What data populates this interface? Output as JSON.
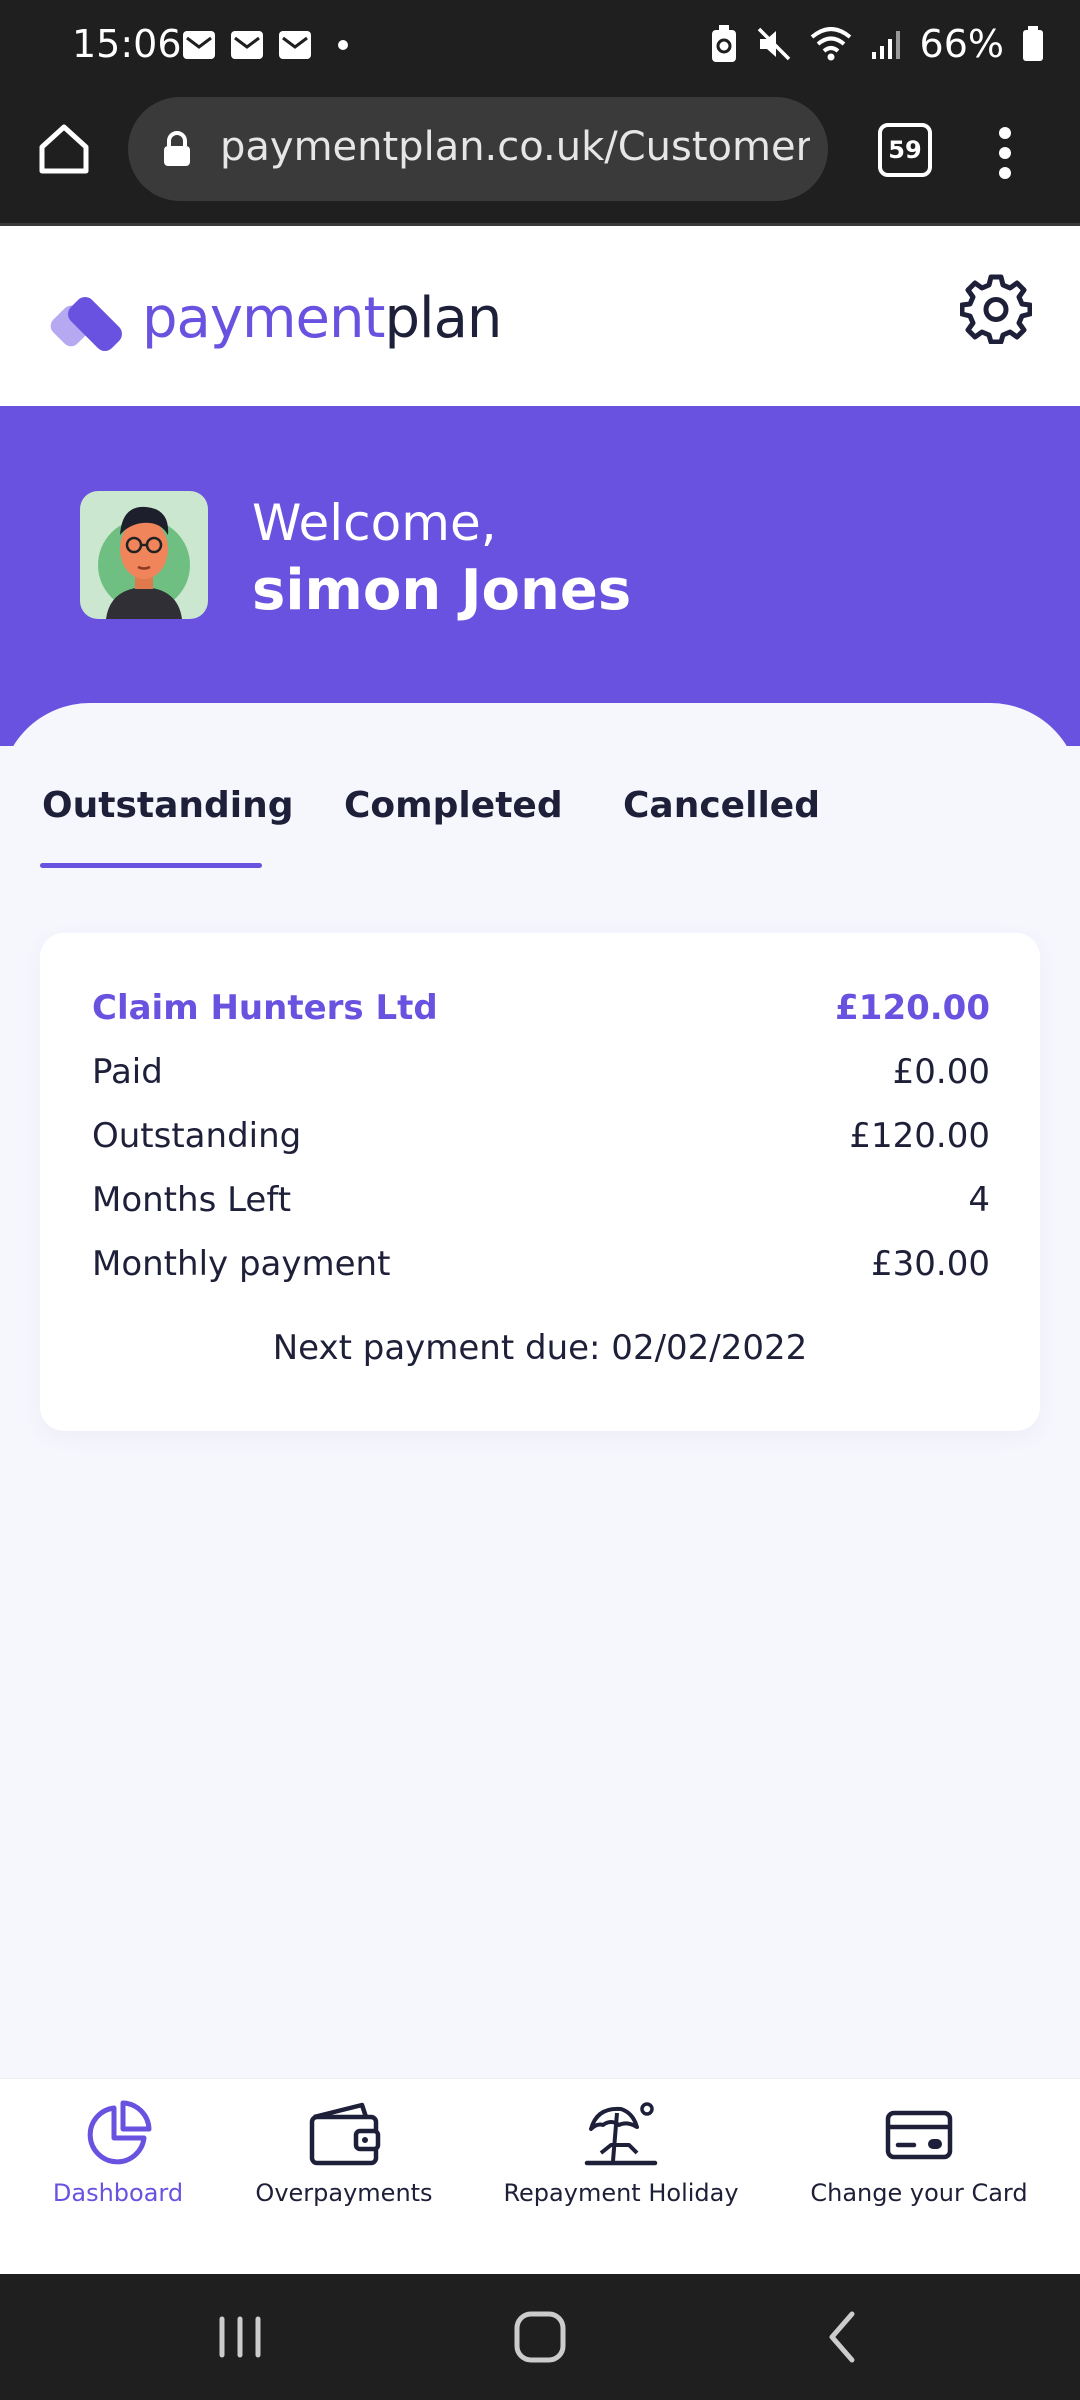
{
  "status_bar": {
    "time": "15:06",
    "battery": "66%"
  },
  "browser": {
    "url": "paymentplan.co.uk/Customer/D",
    "tab_count": "59"
  },
  "app": {
    "brand_first": "payment",
    "brand_second": "plan",
    "welcome_greeting": "Welcome,",
    "user_name": "simon Jones"
  },
  "tabs": [
    {
      "label": "Outstanding",
      "active": true
    },
    {
      "label": "Completed",
      "active": false
    },
    {
      "label": "Cancelled",
      "active": false
    }
  ],
  "plan_card": {
    "company": "Claim Hunters Ltd",
    "total": "£120.00",
    "rows": [
      {
        "label": "Paid",
        "value": "£0.00"
      },
      {
        "label": "Outstanding",
        "value": "£120.00"
      },
      {
        "label": "Months Left",
        "value": "4"
      },
      {
        "label": "Monthly payment",
        "value": "£30.00"
      }
    ],
    "next_payment": "Next payment due: 02/02/2022"
  },
  "bottom_nav": [
    {
      "label": "Dashboard",
      "icon": "pie-chart-icon",
      "active": true
    },
    {
      "label": "Overpayments",
      "icon": "wallet-icon",
      "active": false
    },
    {
      "label": "Repayment Holiday",
      "icon": "beach-umbrella-icon",
      "active": false
    },
    {
      "label": "Change your Card",
      "icon": "credit-card-icon",
      "active": false
    }
  ],
  "colors": {
    "brand_purple": "#6a52e0",
    "text_dark": "#1e1f38",
    "background": "#f6f7fd"
  }
}
